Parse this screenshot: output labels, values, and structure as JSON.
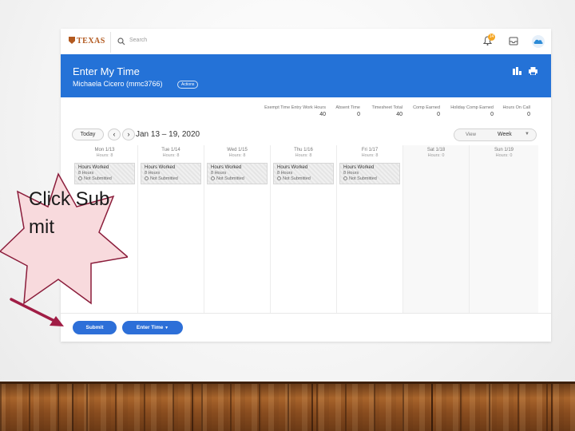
{
  "topbar": {
    "logo_text": "TEXAS",
    "search_placeholder": "Search",
    "notification_count": "14"
  },
  "banner": {
    "title": "Enter My Time",
    "worker_name": "Michaela Cicero (mmc3766)",
    "worker_badge": "Actions"
  },
  "summary": [
    {
      "label": "Exempt Time Entry Work Hours",
      "value": "40"
    },
    {
      "label": "Absent Time",
      "value": "0"
    },
    {
      "label": "Timesheet Total",
      "value": "40"
    },
    {
      "label": "Comp Earned",
      "value": "0"
    },
    {
      "label": "Holiday Comp Earned",
      "value": "0"
    },
    {
      "label": "Hours On Call",
      "value": "0"
    }
  ],
  "nav": {
    "today_label": "Today",
    "prev_label": "‹",
    "next_label": "›",
    "date_range": "Jan 13 – 19, 2020",
    "view_label": "View",
    "view_value": "Week"
  },
  "days": [
    {
      "name": "Mon 1/13",
      "hours": "Hours: 8",
      "entry": {
        "title": "Hours Worked",
        "hours": "8 Hours",
        "status": "Not Submitted"
      }
    },
    {
      "name": "Tue 1/14",
      "hours": "Hours: 8",
      "entry": {
        "title": "Hours Worked",
        "hours": "8 Hours",
        "status": "Not Submitted"
      }
    },
    {
      "name": "Wed 1/15",
      "hours": "Hours: 8",
      "entry": {
        "title": "Hours Worked",
        "hours": "8 Hours",
        "status": "Not Submitted"
      }
    },
    {
      "name": "Thu 1/16",
      "hours": "Hours: 8",
      "entry": {
        "title": "Hours Worked",
        "hours": "8 Hours",
        "status": "Not Submitted"
      }
    },
    {
      "name": "Fri 1/17",
      "hours": "Hours: 8",
      "entry": {
        "title": "Hours Worked",
        "hours": "8 Hours",
        "status": "Not Submitted"
      }
    },
    {
      "name": "Sat 1/18",
      "hours": "Hours: 0"
    },
    {
      "name": "Sun 1/19",
      "hours": "Hours: 0"
    }
  ],
  "footer": {
    "submit_label": "Submit",
    "enter_time_label": "Enter Time"
  },
  "callout": {
    "text": "Click Submit",
    "star_color": "#f8dadd",
    "star_border": "#8b1d3b",
    "arrow_color": "#a01d45"
  },
  "colors": {
    "accent": "#2472d7",
    "button": "#2d6fd8"
  }
}
